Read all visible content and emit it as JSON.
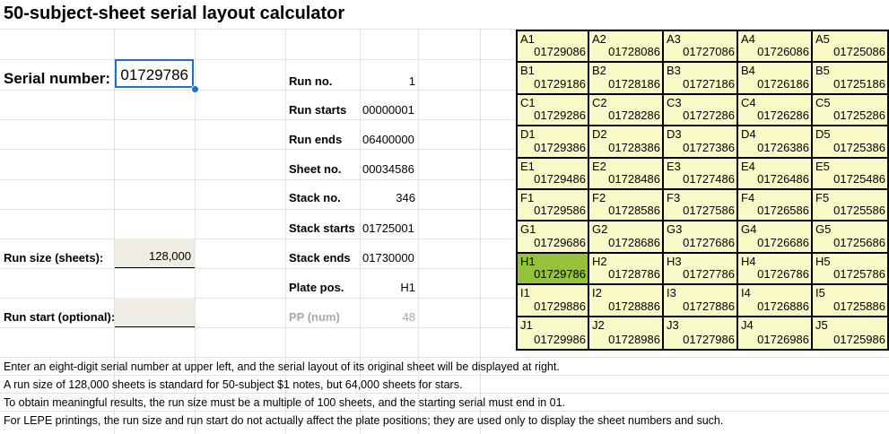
{
  "title": "50-subject-sheet serial layout calculator",
  "serial": {
    "label": "Serial number:",
    "value": "01729786"
  },
  "info": [
    {
      "label": "Run no.",
      "value": "1",
      "align": "right"
    },
    {
      "label": "Run starts",
      "value": "00000001",
      "align": "left"
    },
    {
      "label": "Run ends",
      "value": "06400000",
      "align": "left"
    },
    {
      "label": "Sheet no.",
      "value": "00034586",
      "align": "left"
    },
    {
      "label": "Stack no.",
      "value": "346",
      "align": "right"
    },
    {
      "label": "Stack starts",
      "value": "01725001",
      "align": "left"
    },
    {
      "label": "Stack ends",
      "value": "01730000",
      "align": "left"
    },
    {
      "label": "Plate pos.",
      "value": "H1",
      "align": "right"
    },
    {
      "label": "PP (num)",
      "value": "48",
      "align": "right",
      "muted": true
    }
  ],
  "run_size": {
    "label": "Run size (sheets):",
    "value": "128,000"
  },
  "run_start": {
    "label": "Run start (optional):",
    "value": ""
  },
  "plate": {
    "highlight": "H1",
    "highlight_color": "#95c23d",
    "cell_color": "#fafac9",
    "rows": [
      [
        [
          "A1",
          "01729086"
        ],
        [
          "A2",
          "01728086"
        ],
        [
          "A3",
          "01727086"
        ],
        [
          "A4",
          "01726086"
        ],
        [
          "A5",
          "01725086"
        ]
      ],
      [
        [
          "B1",
          "01729186"
        ],
        [
          "B2",
          "01728186"
        ],
        [
          "B3",
          "01727186"
        ],
        [
          "B4",
          "01726186"
        ],
        [
          "B5",
          "01725186"
        ]
      ],
      [
        [
          "C1",
          "01729286"
        ],
        [
          "C2",
          "01728286"
        ],
        [
          "C3",
          "01727286"
        ],
        [
          "C4",
          "01726286"
        ],
        [
          "C5",
          "01725286"
        ]
      ],
      [
        [
          "D1",
          "01729386"
        ],
        [
          "D2",
          "01728386"
        ],
        [
          "D3",
          "01727386"
        ],
        [
          "D4",
          "01726386"
        ],
        [
          "D5",
          "01725386"
        ]
      ],
      [
        [
          "E1",
          "01729486"
        ],
        [
          "E2",
          "01728486"
        ],
        [
          "E3",
          "01727486"
        ],
        [
          "E4",
          "01726486"
        ],
        [
          "E5",
          "01725486"
        ]
      ],
      [
        [
          "F1",
          "01729586"
        ],
        [
          "F2",
          "01728586"
        ],
        [
          "F3",
          "01727586"
        ],
        [
          "F4",
          "01726586"
        ],
        [
          "F5",
          "01725586"
        ]
      ],
      [
        [
          "G1",
          "01729686"
        ],
        [
          "G2",
          "01728686"
        ],
        [
          "G3",
          "01727686"
        ],
        [
          "G4",
          "01726686"
        ],
        [
          "G5",
          "01725686"
        ]
      ],
      [
        [
          "H1",
          "01729786"
        ],
        [
          "H2",
          "01728786"
        ],
        [
          "H3",
          "01727786"
        ],
        [
          "H4",
          "01726786"
        ],
        [
          "H5",
          "01725786"
        ]
      ],
      [
        [
          "I1",
          "01729886"
        ],
        [
          "I2",
          "01728886"
        ],
        [
          "I3",
          "01727886"
        ],
        [
          "I4",
          "01726886"
        ],
        [
          "I5",
          "01725886"
        ]
      ],
      [
        [
          "J1",
          "01729986"
        ],
        [
          "J2",
          "01728986"
        ],
        [
          "J3",
          "01727986"
        ],
        [
          "J4",
          "01726986"
        ],
        [
          "J5",
          "01725986"
        ]
      ]
    ]
  },
  "notes": [
    "Enter an eight-digit serial number at upper left, and the serial layout of its original sheet will be displayed at right.",
    "A run size of 128,000 sheets is standard for 50-subject $1 notes, but 64,000 sheets for stars.",
    "To obtain meaningful results, the run size must be a multiple of 100 sheets, and the starting serial must end in 01.",
    "For LEPE printings, the run size and run start do not actually affect the plate positions; they are used only to display the sheet numbers and such."
  ]
}
